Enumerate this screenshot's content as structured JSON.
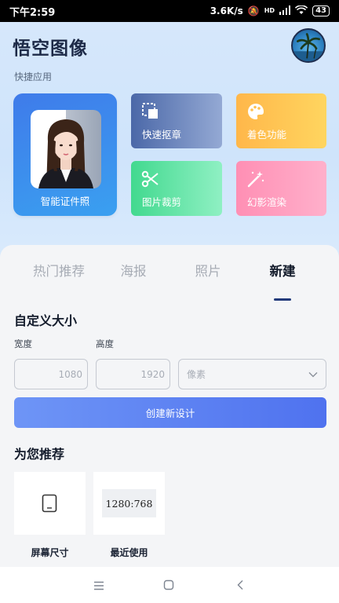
{
  "status_bar": {
    "time": "下午2:59",
    "speed": "3.6K/s",
    "signal_label": "HD",
    "battery": "43"
  },
  "header": {
    "title": "悟空图像"
  },
  "quick": {
    "section_label": "快捷应用",
    "id_photo_label": "智能证件照",
    "tiles": [
      {
        "label": "快速抠章",
        "icon": "crop-select-icon"
      },
      {
        "label": "着色功能",
        "icon": "palette-icon"
      },
      {
        "label": "图片裁剪",
        "icon": "scissors-icon"
      },
      {
        "label": "幻影渲染",
        "icon": "magic-wand-icon"
      }
    ]
  },
  "tabs": [
    {
      "label": "热门推荐",
      "active": false
    },
    {
      "label": "海报",
      "active": false
    },
    {
      "label": "照片",
      "active": false
    },
    {
      "label": "新建",
      "active": true
    }
  ],
  "custom_size": {
    "title": "自定义大小",
    "width_label": "宽度",
    "height_label": "高度",
    "width_placeholder": "1080",
    "height_placeholder": "1920",
    "unit_selected": "像素",
    "create_button": "创建新设计"
  },
  "recommend": {
    "title": "为您推荐",
    "items": [
      {
        "label": "屏幕尺寸",
        "icon": "tablet-icon"
      },
      {
        "label": "最近使用",
        "ratio": "1280:768"
      }
    ]
  },
  "colors": {
    "accent": "#4f72ef",
    "id_card": "#3f7bea"
  }
}
